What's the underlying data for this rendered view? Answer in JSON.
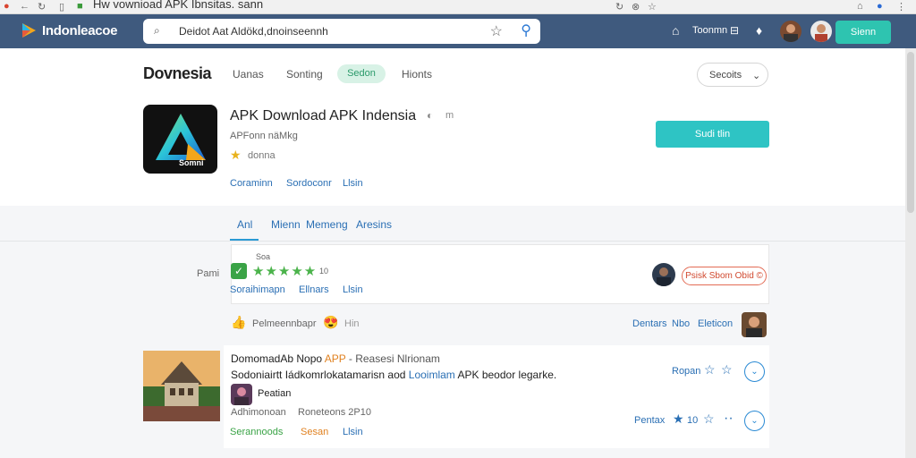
{
  "browser": {
    "tab_title": "Hw vownioad APK  Ibnsitas. sann"
  },
  "header": {
    "brand": "Indonleacoe",
    "search_query": "Deidot Aat Aldökd,dnoinseennh",
    "right_label": "Toonmn",
    "button_label": "Sienn",
    "colors": {
      "bar": "#3f5a7e",
      "button": "#2ec4b0"
    }
  },
  "nav": {
    "logo": "Dovnesia",
    "items": [
      "Uanas",
      "Sonting",
      "Sedon",
      "Hionts"
    ],
    "active_index": 2,
    "select_label": "Secoits"
  },
  "app": {
    "title": "APK Download APK Indensia",
    "subtitle": "APFonn näMkg",
    "rating_text": "donna",
    "icon_caption": "Somni",
    "links": [
      "Coraminn",
      "Sordoconr",
      "Llsin"
    ],
    "install_label": "Sudi tlin"
  },
  "tabs": [
    "Anl",
    "Mienn",
    "Memeng",
    "Aresins"
  ],
  "review_card": {
    "left_label": "Pami",
    "above_stars": "Soa",
    "stars": 5,
    "count": "10",
    "links": [
      "Soraihimapn",
      "Ellnars",
      "Llsin"
    ],
    "badge": "Psisk Sbom Obid ©"
  },
  "like_row": {
    "text": "Pelmeennbapr",
    "trailing": "Hin",
    "right_links": [
      "Dentars",
      "Nbo",
      "Eleticon"
    ]
  },
  "post": {
    "title_a": "DomomadAb Nopo",
    "title_b": "APP",
    "title_c": "- Reasesi Nlrionam",
    "line2_a": "Sodoniairtt Iádkomrlokatamarisn aod",
    "line2_b": "Looimlam",
    "line2_c": "APK beodor legarke.",
    "author": "Peatian",
    "meta_a": "Adhimonoan",
    "meta_b": "Roneteons 2P10",
    "links": [
      "Serannoods",
      "Sesan",
      "Llsin"
    ],
    "action1": "Ropan",
    "action2": "Pentax",
    "action2_num": "10"
  }
}
